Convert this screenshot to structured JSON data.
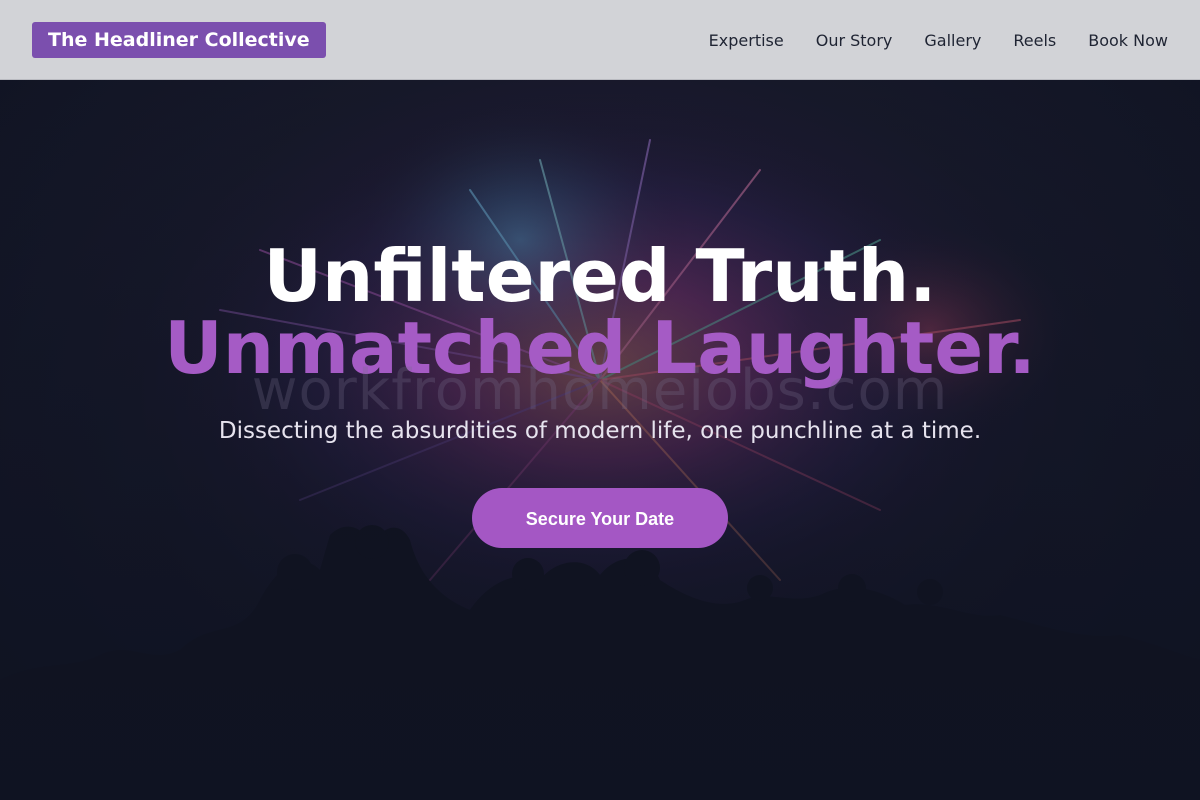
{
  "nav": {
    "brand": "The Headliner Collective",
    "links": [
      "Expertise",
      "Our Story",
      "Gallery",
      "Reels",
      "Book Now"
    ]
  },
  "hero": {
    "headline_line1": "Unfiltered Truth.",
    "headline_line2": "Unmatched Laughter.",
    "watermark": "workfromhomejobs.com",
    "subtitle": "Dissecting the absurdities of modern life, one punchline at a time.",
    "cta_label": "Secure Your Date",
    "background_image": "fireworks-crowd-silhouette"
  },
  "colors": {
    "nav_bg": "#d2d3d7",
    "brand_bg": "#7b4fae",
    "accent": "#a55bc5",
    "hero_bg": "#0f1322"
  }
}
